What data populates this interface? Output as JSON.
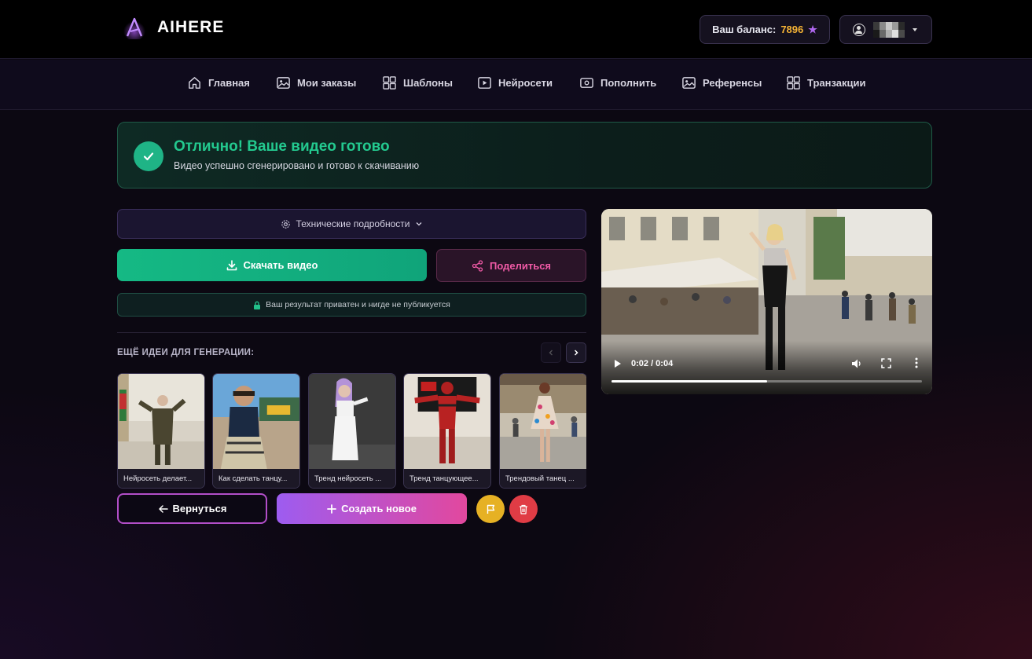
{
  "header": {
    "logo_text": "AIHERE",
    "balance_label": "Ваш баланс:",
    "balance_value": "7896",
    "balance_icon": "star-icon",
    "user_icon": "user-circle-icon"
  },
  "nav": {
    "items": [
      {
        "label": "Главная",
        "icon": "home-icon"
      },
      {
        "label": "Мои заказы",
        "icon": "image-icon"
      },
      {
        "label": "Шаблоны",
        "icon": "grid-icon"
      },
      {
        "label": "Нейросети",
        "icon": "play-icon"
      },
      {
        "label": "Пополнить",
        "icon": "wallet-icon"
      },
      {
        "label": "Референсы",
        "icon": "image-icon"
      },
      {
        "label": "Транзакции",
        "icon": "grid-icon"
      }
    ]
  },
  "success": {
    "title": "Отлично! Ваше видео готово",
    "subtitle": "Видео успешно сгенерировано и готово к скачиванию"
  },
  "actions": {
    "tech_details": "Технические подробности",
    "download": "Скачать видео",
    "share": "Поделиться",
    "private_note": "Ваш результат приватен и нигде не публикуется"
  },
  "ideas": {
    "title": "ЕЩЁ ИДЕИ ДЛЯ ГЕНЕРАЦИИ:",
    "cards": [
      {
        "caption": "Нейросеть делает..."
      },
      {
        "caption": "Как сделать танцу..."
      },
      {
        "caption": "Тренд нейросеть ..."
      },
      {
        "caption": "Тренд танцующее..."
      },
      {
        "caption": "Трендовый танец ..."
      }
    ]
  },
  "footer_buttons": {
    "back": "Вернуться",
    "create": "Создать новое"
  },
  "video": {
    "time": "0:02 / 0:04",
    "progress": 0.5
  },
  "colors": {
    "accent_green": "#23c98f",
    "balance_value": "#f5b335",
    "share_pink": "#f05aa6",
    "flag_yellow": "#e6b124",
    "trash_red": "#e03c45"
  }
}
